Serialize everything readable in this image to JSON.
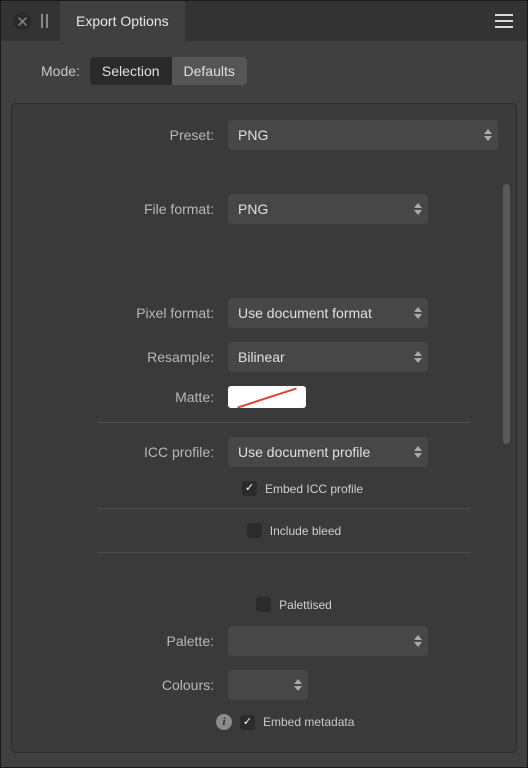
{
  "header": {
    "title": "Export Options"
  },
  "mode": {
    "label": "Mode:",
    "options": {
      "selection": "Selection",
      "defaults": "Defaults"
    },
    "active": "selection"
  },
  "preset": {
    "label": "Preset:",
    "value": "PNG"
  },
  "file_format": {
    "label": "File format:",
    "value": "PNG"
  },
  "pixel_format": {
    "label": "Pixel format:",
    "value": "Use document format"
  },
  "resample": {
    "label": "Resample:",
    "value": "Bilinear"
  },
  "matte": {
    "label": "Matte:"
  },
  "icc_profile": {
    "label": "ICC profile:",
    "value": "Use document profile",
    "embed_label": "Embed ICC profile",
    "embed_checked": true
  },
  "include_bleed": {
    "label": "Include bleed",
    "checked": false
  },
  "palettised": {
    "label": "Palettised",
    "checked": false
  },
  "palette": {
    "label": "Palette:",
    "value": ""
  },
  "colours": {
    "label": "Colours:",
    "value": ""
  },
  "embed_metadata": {
    "label": "Embed metadata",
    "checked": true
  },
  "colors": {
    "panel_bg": "#3a3a3a",
    "card_bg": "#404040",
    "select_bg": "#474747",
    "text": "#c8c8c8"
  }
}
